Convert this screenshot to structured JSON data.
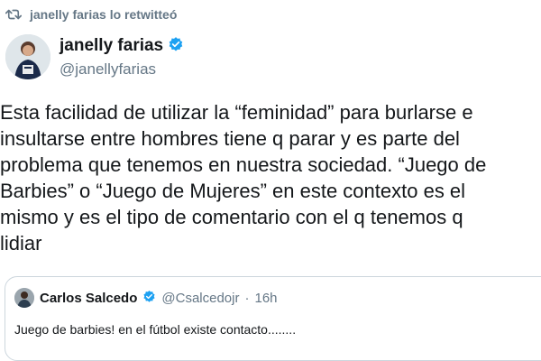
{
  "retweet": {
    "icon": "retweet-icon",
    "text": "janelly farias lo retwitteó"
  },
  "tweet": {
    "author": {
      "avatar": "avatar",
      "name": "janelly farias",
      "verified_icon": "verified-badge-icon",
      "handle": "@janellyfarias"
    },
    "text_lines": [
      "Esta facilidad de utilizar la “feminidad” para burlarse e",
      "insultarse entre hombres tiene q parar y es parte del",
      "problema que tenemos en nuestra sociedad. “Juego de",
      "Barbies” o “Juego de Mujeres” en este contexto es el",
      "mismo y es el tipo de comentario con el q tenemos q",
      "lidiar"
    ]
  },
  "quote": {
    "author_name": "Carlos Salcedo",
    "verified_icon": "verified-badge-icon",
    "handle": "@Csalcedojr",
    "separator": "·",
    "time": "16h",
    "text": "Juego de barbies! en el fútbol existe contacto........"
  },
  "colors": {
    "verified": "#1da1f2",
    "secondary_text": "#657786",
    "border": "#ccd6dd"
  }
}
